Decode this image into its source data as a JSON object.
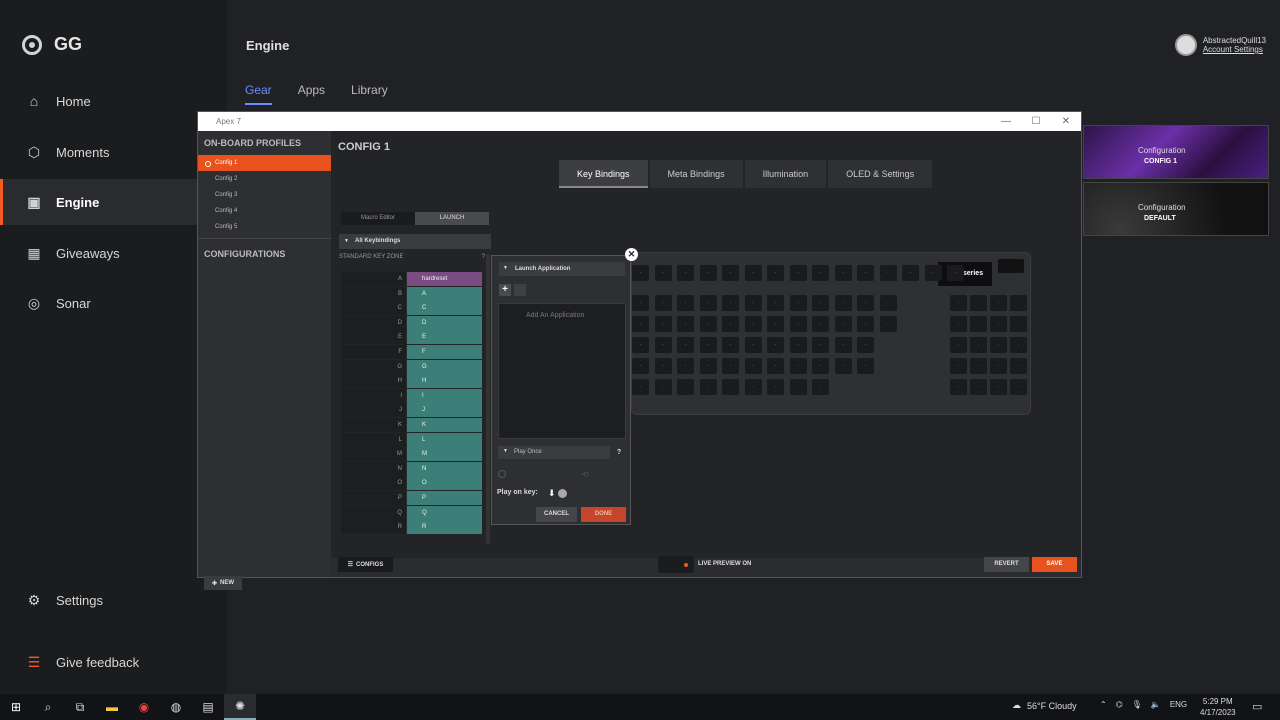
{
  "app": {
    "name": "GG"
  },
  "sidebar": {
    "items": [
      {
        "label": "Home",
        "icon": "home-icon"
      },
      {
        "label": "Moments",
        "icon": "hexagon-icon"
      },
      {
        "label": "Engine",
        "icon": "chip-icon"
      },
      {
        "label": "Giveaways",
        "icon": "gift-icon"
      },
      {
        "label": "Sonar",
        "icon": "sonar-icon"
      }
    ],
    "settings_label": "Settings",
    "feedback_label": "Give feedback"
  },
  "header": {
    "title": "Engine",
    "tabs": [
      "Gear",
      "Apps",
      "Library"
    ],
    "account": {
      "user": "AbstractedQuill13",
      "link": "Account Settings"
    }
  },
  "config_cards": [
    {
      "label": "Configuration",
      "value": "CONFIG 1"
    },
    {
      "label": "Configuration",
      "value": "DEFAULT"
    }
  ],
  "device_window": {
    "title": "Apex 7",
    "onboard_profiles_label": "ON-BOARD PROFILES",
    "profiles": [
      "Config 1",
      "Config 2",
      "Config 3",
      "Config 4",
      "Config 5"
    ],
    "configurations_label": "CONFIGURATIONS",
    "new_label": "NEW",
    "config_title": "CONFIG 1",
    "binding_tabs": [
      "Key Bindings",
      "Meta Bindings",
      "Illumination",
      "OLED & Settings"
    ],
    "macro_editor_label": "Macro Editor",
    "launch_label": "LAUNCH",
    "all_keybindings_label": "All Keybindings",
    "standard_key_zone_label": "STANDARD KEY ZONE",
    "key_zone_help": "?",
    "keys": [
      {
        "key": "A",
        "binding": "hardreset"
      },
      {
        "key": "B",
        "binding": "A"
      },
      {
        "key": "C",
        "binding": "C"
      },
      {
        "key": "D",
        "binding": "D"
      },
      {
        "key": "E",
        "binding": "E"
      },
      {
        "key": "F",
        "binding": "F"
      },
      {
        "key": "G",
        "binding": "G"
      },
      {
        "key": "H",
        "binding": "H"
      },
      {
        "key": "I",
        "binding": "I"
      },
      {
        "key": "J",
        "binding": "J"
      },
      {
        "key": "K",
        "binding": "K"
      },
      {
        "key": "L",
        "binding": "L"
      },
      {
        "key": "M",
        "binding": "M"
      },
      {
        "key": "N",
        "binding": "N"
      },
      {
        "key": "O",
        "binding": "O"
      },
      {
        "key": "P",
        "binding": "P"
      },
      {
        "key": "Q",
        "binding": "Q"
      },
      {
        "key": "R",
        "binding": "R"
      }
    ],
    "launch_popup": {
      "header": "Launch Application",
      "add_app_placeholder": "Add An Application",
      "play_mode": "Play Once",
      "help": "?",
      "play_on_key_label": "Play on key:",
      "cancel_label": "CANCEL",
      "done_label": "DONE"
    },
    "keyboard_brand": "steelseries",
    "configs_label": "CONFIGS",
    "live_preview_label": "LIVE PREVIEW ON",
    "revert_label": "REVERT",
    "save_label": "SAVE"
  },
  "taskbar": {
    "weather": "56°F  Cloudy",
    "lang": "ENG",
    "time": "5:29 PM",
    "date": "4/17/2023"
  },
  "colors": {
    "accent": "#f15a22",
    "tab_active": "#6a8cff",
    "teal": "#3b7f78",
    "macro": "#7a4c82"
  }
}
